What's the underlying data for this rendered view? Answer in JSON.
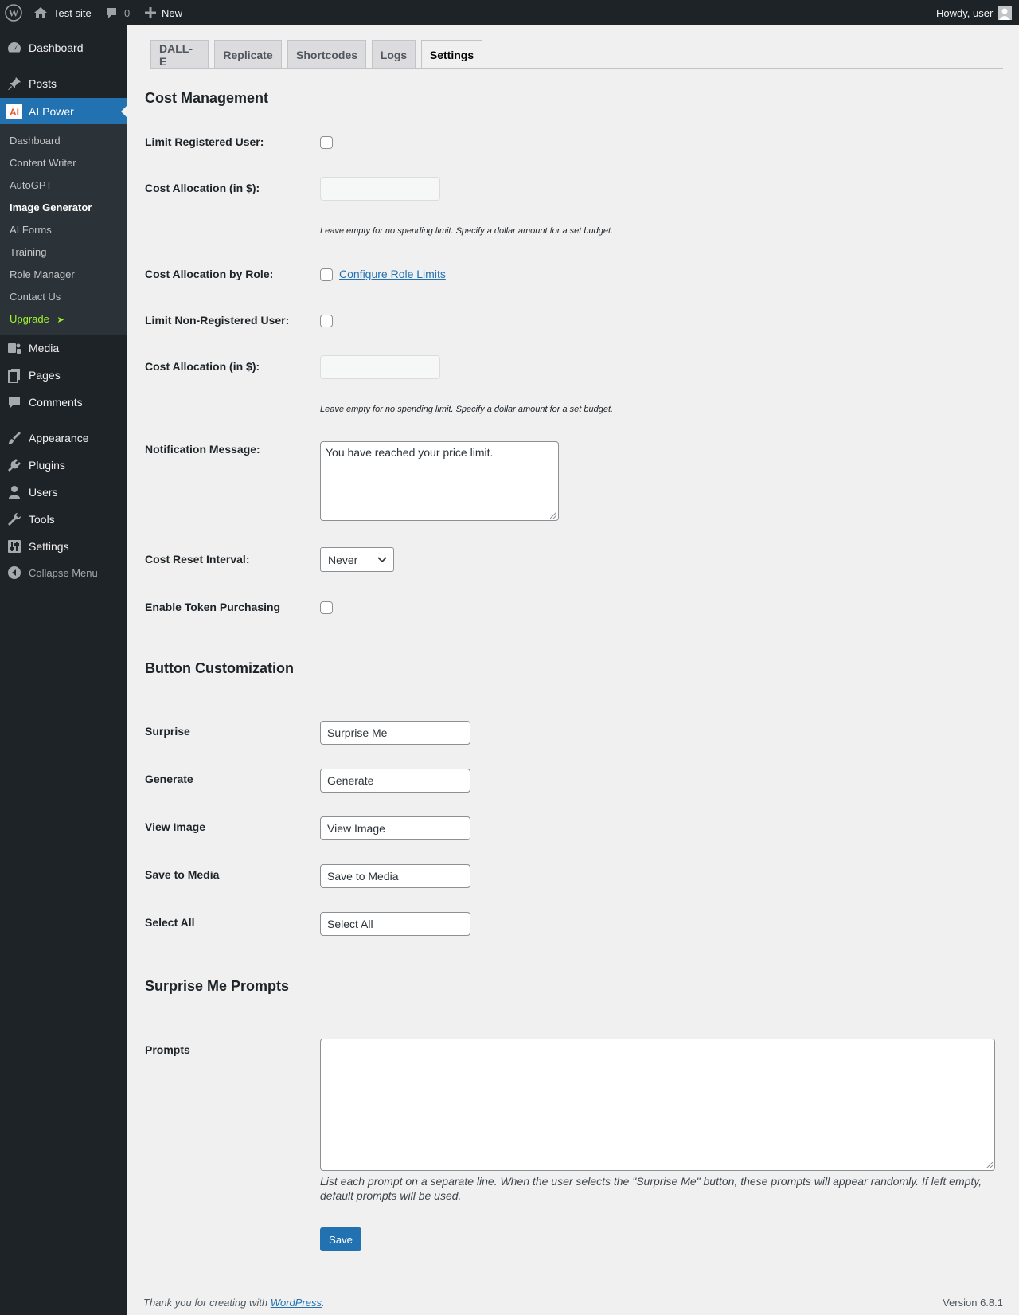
{
  "adminbar": {
    "site_name": "Test site",
    "comments_count": "0",
    "new_label": "New",
    "howdy": "Howdy, user"
  },
  "sidebar": {
    "items": [
      {
        "label": "Dashboard",
        "icon": "dashboard-icon"
      },
      {
        "label": "Posts",
        "icon": "pin-icon"
      },
      {
        "label": "AI Power",
        "icon": "ai-power-icon"
      },
      {
        "label": "Media",
        "icon": "media-icon"
      },
      {
        "label": "Pages",
        "icon": "pages-icon"
      },
      {
        "label": "Comments",
        "icon": "comment-icon"
      },
      {
        "label": "Appearance",
        "icon": "brush-icon"
      },
      {
        "label": "Plugins",
        "icon": "plugin-icon"
      },
      {
        "label": "Users",
        "icon": "user-icon"
      },
      {
        "label": "Tools",
        "icon": "wrench-icon"
      },
      {
        "label": "Settings",
        "icon": "sliders-icon"
      }
    ],
    "collapse_label": "Collapse Menu",
    "submenu": [
      "Dashboard",
      "Content Writer",
      "AutoGPT",
      "Image Generator",
      "AI Forms",
      "Training",
      "Role Manager",
      "Contact Us",
      "Upgrade"
    ],
    "upgrade_arrow": "➤"
  },
  "tabs": [
    "DALL-E",
    "Replicate",
    "Shortcodes",
    "Logs",
    "Settings"
  ],
  "cost": {
    "heading": "Cost Management",
    "limit_registered_label": "Limit Registered User:",
    "cost_allocation_label": "Cost Allocation (in $):",
    "cost_desc": "Leave empty for no spending limit. Specify a dollar amount for a set budget.",
    "by_role_label": "Cost Allocation by Role:",
    "configure_link": "Configure Role Limits",
    "limit_nonreg_label": "Limit Non-Registered User:",
    "cost_allocation2_label": "Cost Allocation (in $):",
    "cost_desc2": "Leave empty for no spending limit. Specify a dollar amount for a set budget.",
    "notification_label": "Notification Message:",
    "notification_value": "You have reached your price limit.",
    "reset_label": "Cost Reset Interval:",
    "reset_value": "Never",
    "token_label": "Enable Token Purchasing"
  },
  "buttons": {
    "heading": "Button Customization",
    "rows": [
      {
        "label": "Surprise",
        "value": "Surprise Me"
      },
      {
        "label": "Generate",
        "value": "Generate"
      },
      {
        "label": "View Image",
        "value": "View Image"
      },
      {
        "label": "Save to Media",
        "value": "Save to Media"
      },
      {
        "label": "Select All",
        "value": "Select All"
      }
    ]
  },
  "prompts": {
    "heading": "Surprise Me Prompts",
    "label": "Prompts",
    "value": "",
    "description": "List each prompt on a separate line. When the user selects the \"Surprise Me\" button, these prompts will appear randomly. If left empty, default prompts will be used."
  },
  "save_label": "Save",
  "footer": {
    "thanks_prefix": "Thank you for creating with ",
    "wp_link": "WordPress",
    "thanks_suffix": ".",
    "version": "Version 6.8.1"
  }
}
